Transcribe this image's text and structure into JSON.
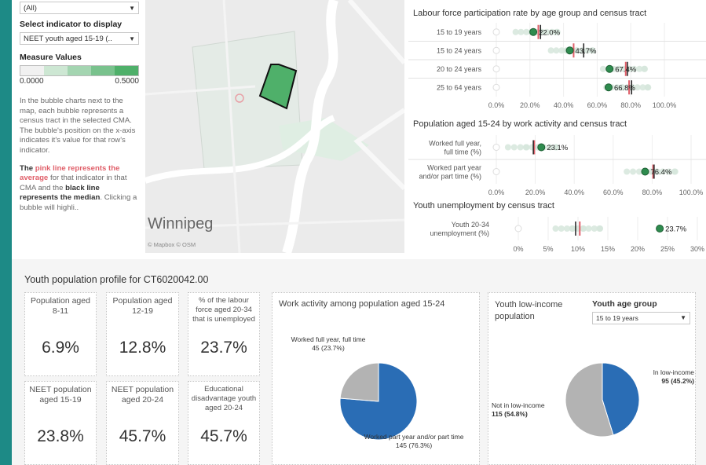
{
  "controls": {
    "region_select": "(All)",
    "indicator_label": "Select indicator to display",
    "indicator_select": "NEET youth aged 15-19 (..",
    "measure_label": "Measure Values",
    "legend_min": "0.0000",
    "legend_max": "0.5000",
    "legend_colors": [
      "#f1f1f1",
      "#cde7d3",
      "#a4d5b1",
      "#79c28d",
      "#4fb06a"
    ],
    "description": "In the bubble charts next to the map, each bubble represents a census tract in the selected CMA. The bubble's position on the x-axis indicates it's value for that row's indicator.",
    "note_the": "The ",
    "note_pink": "pink line represents the average",
    "note_mid": " for that indicator in that CMA and the ",
    "note_black": "black line represents the median",
    "note_end": ". Clicking a bubble will highli.."
  },
  "map": {
    "city": "Winnipeg",
    "credit": "© Mapbox © OSM"
  },
  "chart1": {
    "title": "Labour force participation rate by age group and census tract",
    "rows": [
      {
        "label": "15 to 19 years",
        "value": 22.0,
        "value_label": "22.0%",
        "mean": 25.0,
        "median": 26.3
      },
      {
        "label": "15 to 24 years",
        "value": 43.7,
        "value_label": "43.7%",
        "mean": 46.0,
        "median": 52.0
      },
      {
        "label": "20 to 24 years",
        "value": 67.4,
        "value_label": "67.4%",
        "mean": 77.0,
        "median": 78.0
      },
      {
        "label": "25 to 64 years",
        "value": 66.8,
        "value_label": "66.8%",
        "mean": 79.0,
        "median": 80.5
      }
    ],
    "ticks": [
      "0.0%",
      "20.0%",
      "40.0%",
      "60.0%",
      "80.0%",
      "100.0%"
    ],
    "xlim": [
      0,
      100
    ]
  },
  "chart2": {
    "title": "Population aged 15-24 by work activity and census tract",
    "rows": [
      {
        "label1": "Worked full year,",
        "label2": "full time (%)",
        "value": 23.1,
        "value_label": "23.1%",
        "mean": 19.5,
        "median": 19.0
      },
      {
        "label1": "Worked part year",
        "label2": "and/or part time (%)",
        "value": 76.4,
        "value_label": "76.4%",
        "mean": 80.5,
        "median": 81.0
      }
    ],
    "ticks": [
      "0.0%",
      "20.0%",
      "40.0%",
      "60.0%",
      "80.0%",
      "100.0%"
    ],
    "xlim": [
      0,
      100
    ]
  },
  "chart3": {
    "title": "Youth unemployment by census tract",
    "rows": [
      {
        "label1": "Youth 20-34",
        "label2": "unemployment (%)",
        "value": 23.7,
        "value_label": "23.7%",
        "mean": 10.3,
        "median": 9.6
      }
    ],
    "ticks": [
      "0%",
      "5%",
      "10%",
      "15%",
      "20%",
      "25%",
      "30%"
    ],
    "xlim": [
      0,
      30
    ]
  },
  "colors": {
    "bubble": "#d6e6dc",
    "highlight": "#2e8b4e",
    "mean": "#e0606a",
    "median": "#222222"
  },
  "profile": {
    "title": "Youth population profile for CT6020042.00",
    "cards": [
      {
        "title": "Population aged 8-11",
        "value": "6.9%"
      },
      {
        "title": "Population aged 12-19",
        "value": "12.8%"
      },
      {
        "title": "% of the labour force aged 20-34 that is unemployed",
        "value": "23.7%"
      },
      {
        "title": "NEET population aged 15-19",
        "value": "23.8%"
      },
      {
        "title": "NEET population aged 20-24",
        "value": "45.7%"
      },
      {
        "title": "Educational disadvantage youth aged 20-24",
        "value": "45.7%"
      }
    ],
    "work_activity": {
      "title": "Work activity among population aged 15-24",
      "slice1_label": "Worked full year, full time",
      "slice1_value": "45 (23.7%)",
      "slice1_pct": 23.7,
      "slice2_label": "Worked part year and/or part time",
      "slice2_value": "145 (76.3%)",
      "slice2_pct": 76.3
    },
    "low_income": {
      "title": "Youth low-income population",
      "group_label": "Youth age group",
      "group_select": "15 to 19 years",
      "in_label": "In low-income",
      "in_value": "95 (45.2%)",
      "in_pct": 45.2,
      "not_label": "Not in low-income",
      "not_value": "115 (54.8%)",
      "not_pct": 54.8
    },
    "pie_colors": {
      "blue": "#2a6db5",
      "grey": "#b3b3b3"
    }
  }
}
